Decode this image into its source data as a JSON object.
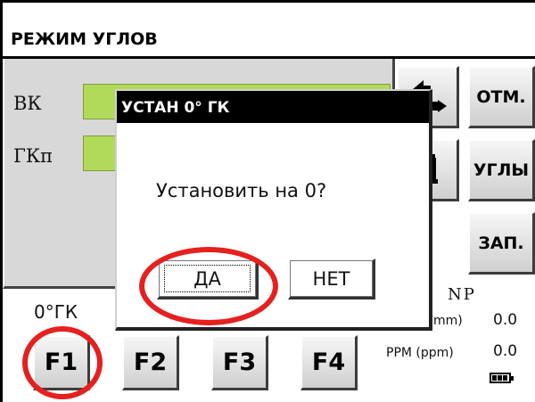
{
  "header": {
    "title": "РЕЖИМ УГЛОВ"
  },
  "angles": {
    "vk_label": "ВК",
    "gk_label": "ГКп"
  },
  "side_buttons": {
    "mark": "ОТМ.",
    "angles": "УГЛЫ",
    "record": "ЗАП."
  },
  "function_keys": {
    "f1_caption": "0°ГК",
    "f1": "F1",
    "f2": "F2",
    "f3": "F3",
    "f4": "F4"
  },
  "status": {
    "np": "NP",
    "mm_label": "mm)",
    "mm_value": "0.0",
    "ppm_label": "PPM (ppm)",
    "ppm_value": "0.0"
  },
  "dialog": {
    "title": "УСТАН 0° ГК",
    "message": "Установить на 0?",
    "yes_label": "ДА",
    "no_label": "НЕТ"
  },
  "icons": [
    "arrow-icon",
    "device-icon",
    "battery-icon"
  ],
  "colors": {
    "field_green": "#b2da5a",
    "annotation_red": "#e5201f",
    "dialog_title_bg": "#000000"
  }
}
